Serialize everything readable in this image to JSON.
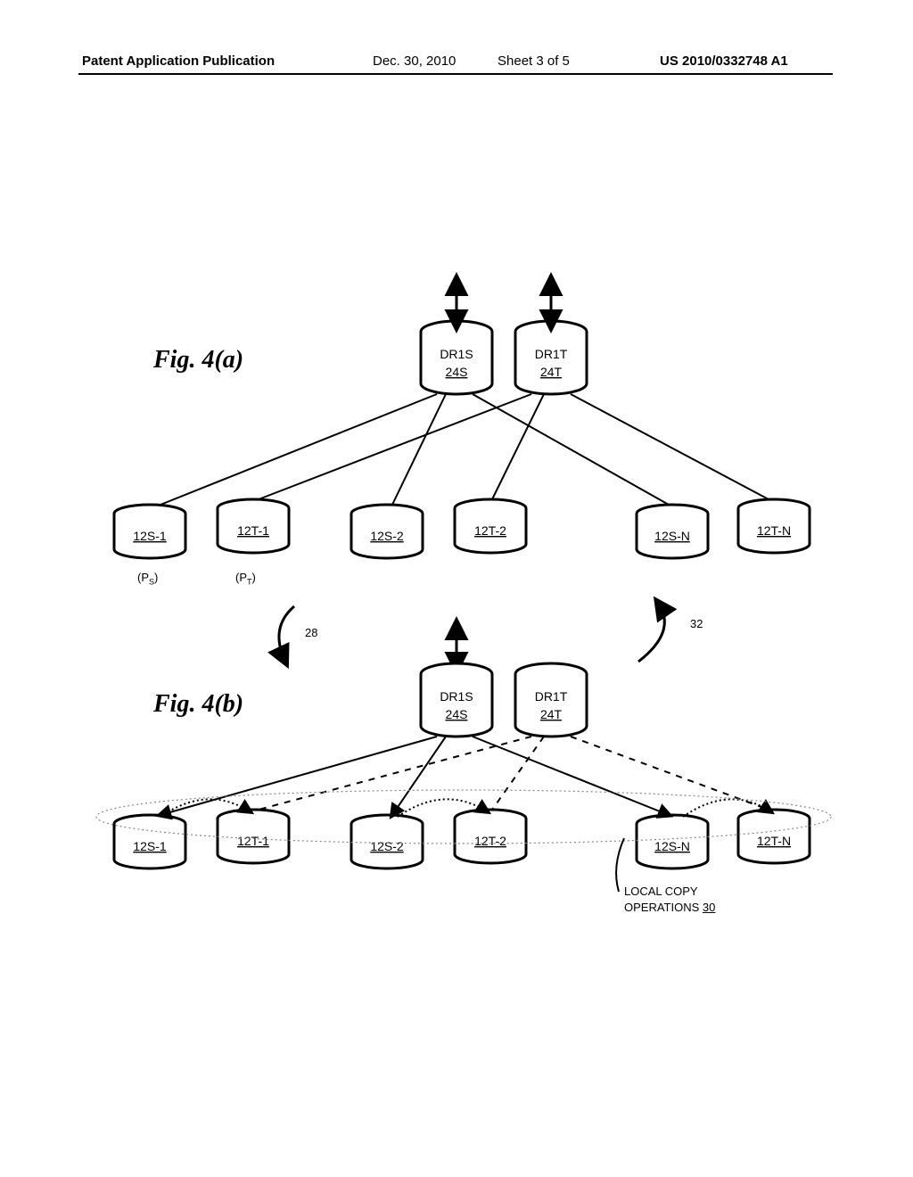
{
  "header": {
    "left": "Patent Application Publication",
    "date": "Dec. 30, 2010",
    "sheet": "Sheet 3 of 5",
    "pub": "US 2010/0332748 A1"
  },
  "fig_a": {
    "label": "Fig. 4(a)",
    "top_s": {
      "name": "DR1S",
      "ref": "24S"
    },
    "top_t": {
      "name": "DR1T",
      "ref": "24T"
    },
    "bottom": {
      "s1": "12S-1",
      "t1": "12T-1",
      "s2": "12S-2",
      "t2": "12T-2",
      "sn": "12S-N",
      "tn": "12T-N"
    },
    "ps": "P",
    "ps_sub": "S",
    "pt": "P",
    "pt_sub": "T"
  },
  "fig_b": {
    "label": "Fig. 4(b)",
    "ref28": "28",
    "ref32": "32",
    "top_s": {
      "name": "DR1S",
      "ref": "24S"
    },
    "top_t": {
      "name": "DR1T",
      "ref": "24T"
    },
    "bottom": {
      "s1": "12S-1",
      "t1": "12T-1",
      "s2": "12S-2",
      "t2": "12T-2",
      "sn": "12S-N",
      "tn": "12T-N"
    },
    "local_copy_l1": "LOCAL COPY",
    "local_copy_l2": "OPERATIONS ",
    "local_copy_ref": "30"
  }
}
